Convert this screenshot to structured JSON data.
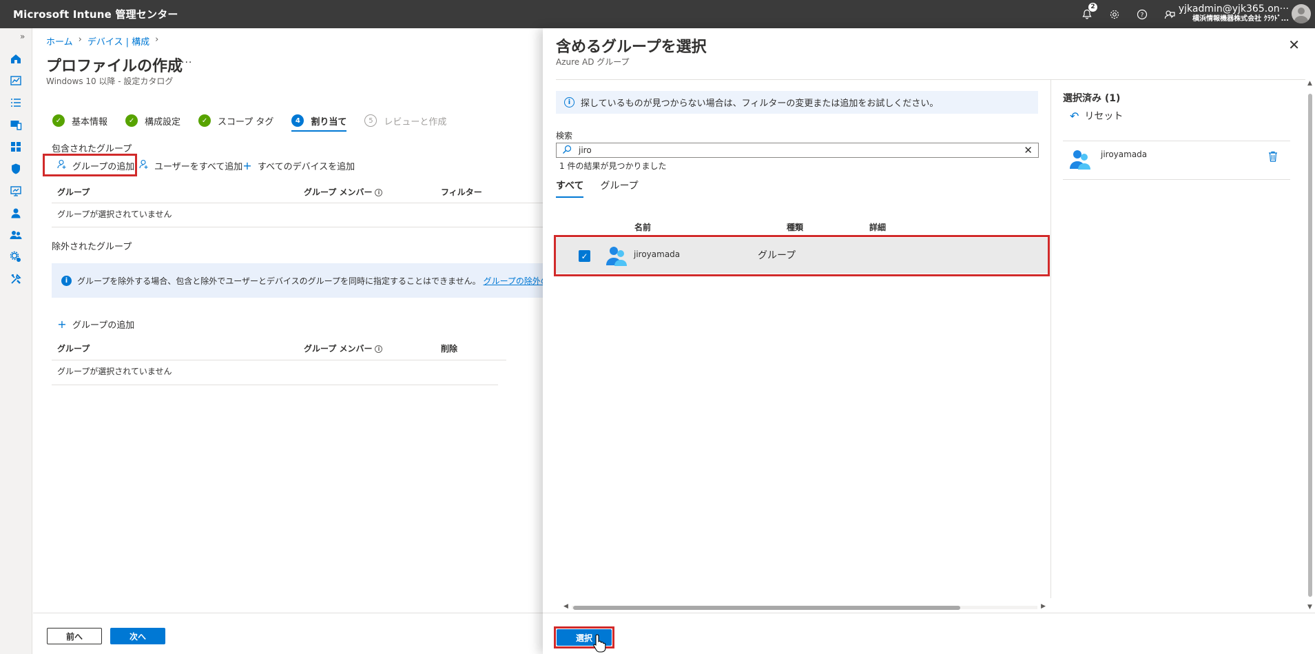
{
  "app": {
    "title": "Microsoft Intune 管理センター"
  },
  "topbar": {
    "notification_count": "2",
    "account_email": "yjkadmin@yjk365.on···",
    "account_org": "横浜情報機器株式会社 ｸﾗｳﾄﾞ..."
  },
  "breadcrumb": {
    "home": "ホーム",
    "devices": "デバイス | 構成"
  },
  "page": {
    "title": "プロファイルの作成",
    "more": "···",
    "subtitle": "Windows 10 以降 - 設定カタログ"
  },
  "steps": [
    {
      "label": "基本情報",
      "state": "done"
    },
    {
      "label": "構成設定",
      "state": "done"
    },
    {
      "label": "スコープ タグ",
      "state": "done"
    },
    {
      "number": "4",
      "label": "割り当て",
      "state": "current"
    },
    {
      "number": "5",
      "label": "レビューと作成",
      "state": "todo"
    }
  ],
  "included": {
    "section_label": "包含されたグループ",
    "add_group": "グループの追加",
    "add_all_users": "ユーザーをすべて追加",
    "add_all_devices": "すべてのデバイスを追加",
    "col_group": "グループ",
    "col_members": "グループ メンバー",
    "col_filter": "フィルター",
    "empty": "グループが選択されていません"
  },
  "excluded": {
    "section_label": "除外されたグループ",
    "info_text": "グループを除外する場合、包含と除外でユーザーとデバイスのグループを同時に指定することはできません。",
    "info_link": "グループの除外の詳細については、ここ",
    "add_group": "グループの追加",
    "col_group": "グループ",
    "col_members": "グループ メンバー",
    "col_delete": "削除",
    "empty": "グループが選択されていません"
  },
  "footer": {
    "prev": "前へ",
    "next": "次へ"
  },
  "panel": {
    "title": "含めるグループを選択",
    "subtitle": "Azure AD グループ",
    "info": "探しているものが見つからない場合は、フィルターの変更または追加をお試しください。",
    "search_label": "検索",
    "search_value": "jiro",
    "result_count": "1 件の結果が見つかりました",
    "tabs": [
      "すべて",
      "グループ"
    ],
    "col_name": "名前",
    "col_type": "種類",
    "col_detail": "詳細",
    "row": {
      "name": "jiroyamada",
      "type": "グループ"
    },
    "selected_title": "選択済み (1)",
    "reset": "リセット",
    "selected_item": "jiroyamada",
    "select_button": "選択"
  },
  "colors": {
    "accent": "#0078d4",
    "highlight": "#d12a2a",
    "success": "#57a300"
  }
}
